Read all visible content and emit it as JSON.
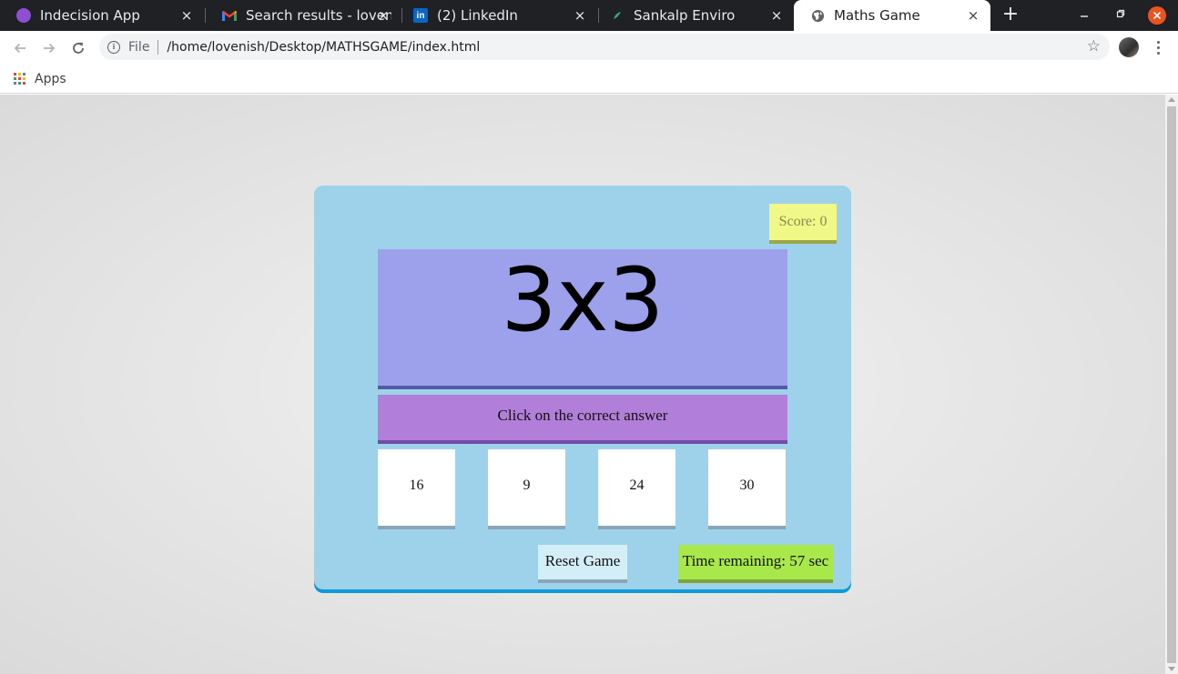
{
  "browser": {
    "tabs": [
      {
        "title": "Indecision App",
        "icon": "indecision-favicon",
        "active": false
      },
      {
        "title": "Search results - lovenish",
        "icon": "gmail-favicon",
        "active": false
      },
      {
        "title": "(2) LinkedIn",
        "icon": "linkedin-favicon",
        "active": false
      },
      {
        "title": "Sankalp Enviro",
        "icon": "sankalp-favicon",
        "active": false
      },
      {
        "title": "Maths Game",
        "icon": "globe-favicon",
        "active": true
      }
    ],
    "tab_close_glyph": "×",
    "new_tab_glyph": "+",
    "address": {
      "scheme_label": "File",
      "url": "/home/lovenish/Desktop/MATHSGAME/index.html"
    },
    "bookmarks": {
      "apps_label": "Apps"
    },
    "colors": {
      "tabstrip": "#202124",
      "window_close": "#e95420"
    }
  },
  "game": {
    "score_label": "Score: 0",
    "question": "3x3",
    "instruction": "Click on the correct answer",
    "choices": [
      "16",
      "9",
      "24",
      "30"
    ],
    "reset_label": "Reset Game",
    "timer_label": "Time remaining: 57 sec",
    "colors": {
      "container": "#9dd2ea",
      "score": "#f0f887",
      "question": "#9da0ea",
      "instruction": "#b17fd9",
      "timer": "#a9e84b",
      "reset": "#d4eef7"
    }
  }
}
